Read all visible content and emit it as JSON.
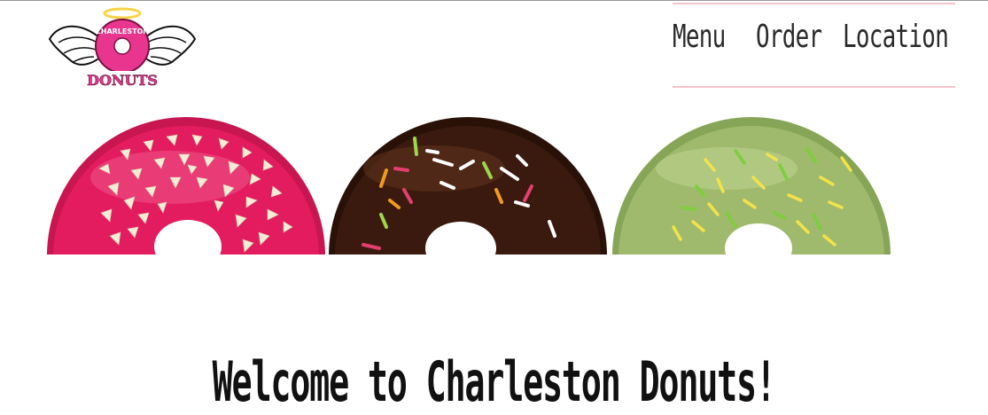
{
  "brand": {
    "logo_line1": "CHARLESTON",
    "logo_line2": "DONUTS",
    "accent_pink": "#e8368f",
    "rule_pink": "#f6c3cd"
  },
  "nav": {
    "items": [
      {
        "label": "Menu"
      },
      {
        "label": "Order"
      },
      {
        "label": "Location"
      }
    ]
  },
  "hero": {
    "donuts": [
      "pink-sprinkled-donut",
      "chocolate-sprinkled-donut",
      "green-sprinkled-donut"
    ],
    "colors": {
      "pink_glaze": "#e31c5f",
      "chocolate_glaze": "#3a1a0e",
      "green_glaze": "#9fba6c"
    }
  },
  "main": {
    "welcome": "Welcome to Charleston Donuts!"
  }
}
